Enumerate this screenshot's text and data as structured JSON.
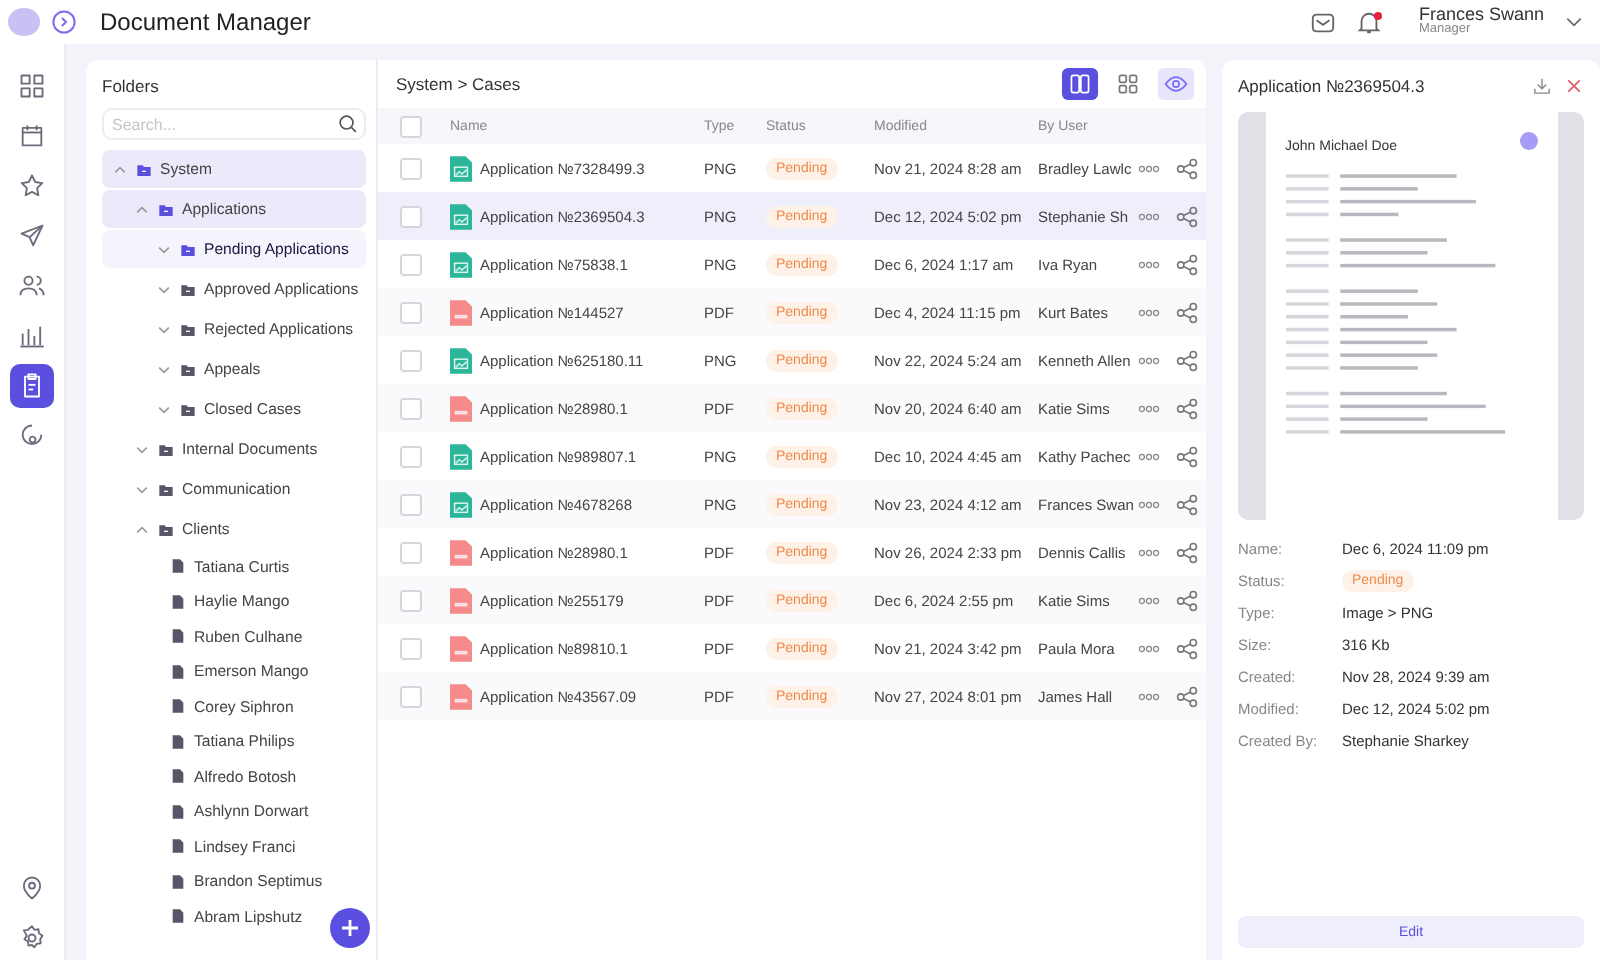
{
  "header": {
    "title": "Document Manager",
    "user": {
      "name": "Frances Swann",
      "role": "Manager"
    },
    "notifications_unread": true
  },
  "nav": [
    {
      "kind": "grid",
      "selected": false
    },
    {
      "kind": "calendar",
      "selected": false
    },
    {
      "kind": "star",
      "selected": false
    },
    {
      "kind": "send",
      "selected": false
    },
    {
      "kind": "users",
      "selected": false
    },
    {
      "kind": "chart",
      "selected": false
    },
    {
      "kind": "clipboard",
      "selected": true
    },
    {
      "kind": "badge",
      "selected": false
    }
  ],
  "nav_bottom": [
    {
      "kind": "pin"
    },
    {
      "kind": "settings"
    }
  ],
  "folders": {
    "title": "Folders",
    "search": {
      "placeholder": "Search..."
    },
    "tree": [
      {
        "label": "System",
        "kind": "folder",
        "expanded": true,
        "highlighted": true,
        "selected": false,
        "children": [
          {
            "label": "Applications",
            "kind": "folder",
            "expanded": true,
            "highlighted": true,
            "selected": false,
            "children": [
              {
                "label": "Pending Applications",
                "kind": "folder",
                "expanded": false,
                "highlighted": false,
                "selected": true
              },
              {
                "label": "Approved Applications",
                "kind": "folder",
                "expanded": false,
                "highlighted": false,
                "selected": false
              },
              {
                "label": "Rejected Applications",
                "kind": "folder",
                "expanded": false,
                "highlighted": false,
                "selected": false
              },
              {
                "label": "Appeals",
                "kind": "folder",
                "expanded": false,
                "highlighted": false,
                "selected": false
              },
              {
                "label": "Closed Cases",
                "kind": "folder",
                "expanded": false,
                "highlighted": false,
                "selected": false
              }
            ]
          },
          {
            "label": "Internal Documents",
            "kind": "folder",
            "expanded": false,
            "highlighted": false,
            "selected": false
          },
          {
            "label": "Communication",
            "kind": "folder",
            "expanded": false,
            "highlighted": false,
            "selected": false
          },
          {
            "label": "Clients",
            "kind": "folder",
            "expanded": true,
            "highlighted": false,
            "selected": false,
            "children": [
              {
                "label": "Tatiana Curtis",
                "kind": "file",
                "selected": false
              },
              {
                "label": "Haylie Mango",
                "kind": "file",
                "selected": false
              },
              {
                "label": "Ruben Culhane",
                "kind": "file",
                "selected": false
              },
              {
                "label": "Emerson Mango",
                "kind": "file",
                "selected": false
              },
              {
                "label": "Corey Siphron",
                "kind": "file",
                "selected": false
              },
              {
                "label": "Tatiana Philips",
                "kind": "file",
                "selected": false
              },
              {
                "label": "Alfredo Botosh",
                "kind": "file",
                "selected": false
              },
              {
                "label": "Ashlynn Dorwart",
                "kind": "file",
                "selected": false
              },
              {
                "label": "Lindsey Franci",
                "kind": "file",
                "selected": false
              },
              {
                "label": "Brandon Septimus",
                "kind": "file",
                "selected": false
              },
              {
                "label": "Abram Lipshutz",
                "kind": "file",
                "selected": false
              }
            ]
          }
        ]
      }
    ]
  },
  "table": {
    "breadcrumb": "System > Cases",
    "views": [
      {
        "kind": "list",
        "selected": true
      },
      {
        "kind": "grid",
        "selected": false
      }
    ],
    "preview_on": true,
    "all_checked": false,
    "columns": [
      "Name",
      "Type",
      "Status",
      "Modified",
      "By User"
    ],
    "rows": [
      {
        "name": "Application №7328499.3",
        "kind": "image",
        "type": "PNG",
        "status": "Pending",
        "modified": "Nov 21, 2024 8:28 am",
        "user": "Bradley Lawlc",
        "checked": false,
        "selected": false
      },
      {
        "name": "Application №2369504.3",
        "kind": "image",
        "type": "PNG",
        "status": "Pending",
        "modified": "Dec 12, 2024 5:02 pm",
        "user": "Stephanie Sh",
        "checked": false,
        "selected": true
      },
      {
        "name": "Application №75838.1",
        "kind": "image",
        "type": "PNG",
        "status": "Pending",
        "modified": "Dec 6, 2024 1:17 am",
        "user": "Iva Ryan",
        "checked": false,
        "selected": false
      },
      {
        "name": "Application №144527",
        "kind": "pdf",
        "type": "PDF",
        "status": "Pending",
        "modified": "Dec 4, 2024 11:15 pm",
        "user": "Kurt Bates",
        "checked": false,
        "selected": false
      },
      {
        "name": "Application №625180.11",
        "kind": "image",
        "type": "PNG",
        "status": "Pending",
        "modified": "Nov 22, 2024 5:24 am",
        "user": "Kenneth Allen",
        "checked": false,
        "selected": false
      },
      {
        "name": "Application №28980.1",
        "kind": "pdf",
        "type": "PDF",
        "status": "Pending",
        "modified": "Nov 20, 2024 6:40 am",
        "user": "Katie Sims",
        "checked": false,
        "selected": false
      },
      {
        "name": "Application №989807.1",
        "kind": "image",
        "type": "PNG",
        "status": "Pending",
        "modified": "Dec 10, 2024 4:45 am",
        "user": "Kathy Pachec",
        "checked": false,
        "selected": false
      },
      {
        "name": "Application №4678268",
        "kind": "image",
        "type": "PNG",
        "status": "Pending",
        "modified": "Nov 23, 2024 4:12 am",
        "user": "Frances Swan",
        "checked": false,
        "selected": false
      },
      {
        "name": "Application №28980.1",
        "kind": "pdf",
        "type": "PDF",
        "status": "Pending",
        "modified": "Nov 26, 2024 2:33 pm",
        "user": "Dennis Callis",
        "checked": false,
        "selected": false
      },
      {
        "name": "Application №255179",
        "kind": "pdf",
        "type": "PDF",
        "status": "Pending",
        "modified": "Dec 6, 2024 2:55 pm",
        "user": "Katie Sims",
        "checked": false,
        "selected": false
      },
      {
        "name": "Application №89810.1",
        "kind": "pdf",
        "type": "PDF",
        "status": "Pending",
        "modified": "Nov 21, 2024 3:42 pm",
        "user": "Paula Mora",
        "checked": false,
        "selected": false
      },
      {
        "name": "Application №43567.09",
        "kind": "pdf",
        "type": "PDF",
        "status": "Pending",
        "modified": "Nov 27, 2024 8:01 pm",
        "user": "James Hall",
        "checked": false,
        "selected": false
      }
    ]
  },
  "detail": {
    "title": "Application №2369504.3",
    "preview_heading": "John Michael Doe",
    "fields": [
      {
        "label": "Name:",
        "value": "Dec 6, 2024 11:09 pm",
        "kind": "text"
      },
      {
        "label": "Status:",
        "value": "Pending",
        "kind": "badge"
      },
      {
        "label": "Type:",
        "value": "Image > PNG",
        "kind": "text"
      },
      {
        "label": "Size:",
        "value": "316 Kb",
        "kind": "text"
      },
      {
        "label": "Created:",
        "value": "Nov 28, 2024 9:39 am",
        "kind": "text"
      },
      {
        "label": "Modified:",
        "value": "Dec 12, 2024 5:02 pm",
        "kind": "text"
      },
      {
        "label": "Created By:",
        "value": "Stephanie Sharkey",
        "kind": "text"
      }
    ],
    "button": "Edit"
  }
}
